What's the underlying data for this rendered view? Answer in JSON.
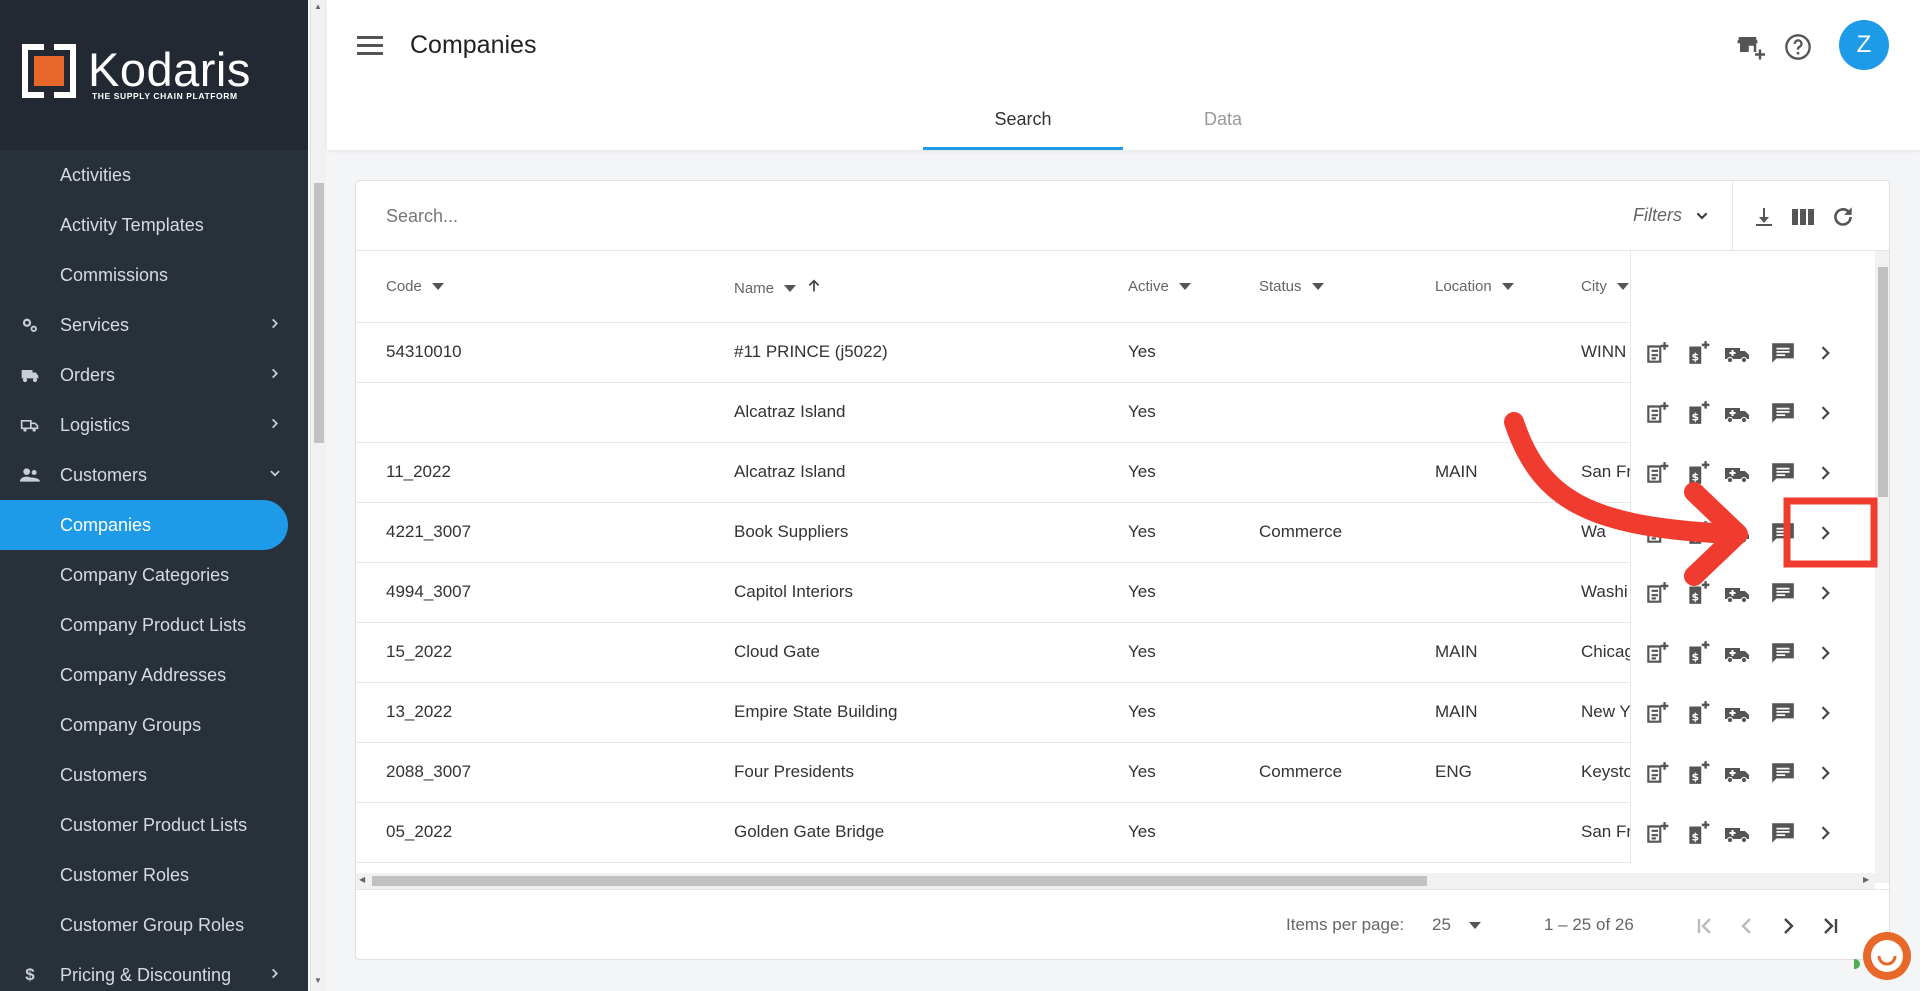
{
  "brand": {
    "name": "Kodaris",
    "tagline": "THE SUPPLY CHAIN PLATFORM",
    "accent": "#1e9be8",
    "logo_orange": "#e8682a"
  },
  "sidebar": {
    "items": [
      {
        "label": "Activities",
        "type": "sub"
      },
      {
        "label": "Activity Templates",
        "type": "sub"
      },
      {
        "label": "Commissions",
        "type": "sub"
      },
      {
        "label": "Services",
        "type": "parent",
        "icon": "gears-icon",
        "chevron": "›"
      },
      {
        "label": "Orders",
        "type": "parent",
        "icon": "truck-icon",
        "chevron": "›"
      },
      {
        "label": "Logistics",
        "type": "parent",
        "icon": "van-icon",
        "chevron": "›"
      },
      {
        "label": "Customers",
        "type": "parent",
        "icon": "people-icon",
        "chevron": "⌄"
      },
      {
        "label": "Companies",
        "type": "sub",
        "active": true
      },
      {
        "label": "Company Categories",
        "type": "sub"
      },
      {
        "label": "Company Product Lists",
        "type": "sub"
      },
      {
        "label": "Company Addresses",
        "type": "sub"
      },
      {
        "label": "Company Groups",
        "type": "sub"
      },
      {
        "label": "Customers",
        "type": "sub"
      },
      {
        "label": "Customer Product Lists",
        "type": "sub"
      },
      {
        "label": "Customer Roles",
        "type": "sub"
      },
      {
        "label": "Customer Group Roles",
        "type": "sub"
      },
      {
        "label": "Pricing & Discounting",
        "type": "parent",
        "icon": "dollar-icon",
        "chevron": "›"
      }
    ]
  },
  "header": {
    "title": "Companies",
    "avatar_letter": "Z",
    "tabs": [
      {
        "label": "Search",
        "active": true
      },
      {
        "label": "Data",
        "active": false
      }
    ]
  },
  "toolbar": {
    "search_placeholder": "Search...",
    "filters_label": "Filters"
  },
  "table": {
    "columns": [
      {
        "key": "code",
        "label": "Code"
      },
      {
        "key": "name",
        "label": "Name"
      },
      {
        "key": "active",
        "label": "Active"
      },
      {
        "key": "status",
        "label": "Status"
      },
      {
        "key": "location",
        "label": "Location"
      },
      {
        "key": "city",
        "label": "City"
      }
    ],
    "rows": [
      {
        "code": "54310010",
        "name": "#11 PRINCE (j5022)",
        "active": "Yes",
        "status": "",
        "location": "",
        "city": "WINN"
      },
      {
        "code": "",
        "name": "Alcatraz Island",
        "active": "Yes",
        "status": "",
        "location": "",
        "city": ""
      },
      {
        "code": "11_2022",
        "name": "Alcatraz Island",
        "active": "Yes",
        "status": "",
        "location": "MAIN",
        "city": "San Fr"
      },
      {
        "code": "4221_3007",
        "name": "Book Suppliers",
        "active": "Yes",
        "status": "Commerce",
        "location": "",
        "city": "Wa"
      },
      {
        "code": "4994_3007",
        "name": "Capitol Interiors",
        "active": "Yes",
        "status": "",
        "location": "",
        "city": "Washi"
      },
      {
        "code": "15_2022",
        "name": "Cloud Gate",
        "active": "Yes",
        "status": "",
        "location": "MAIN",
        "city": "Chicag"
      },
      {
        "code": "13_2022",
        "name": "Empire State Building",
        "active": "Yes",
        "status": "",
        "location": "MAIN",
        "city": "New Y"
      },
      {
        "code": "2088_3007",
        "name": "Four Presidents",
        "active": "Yes",
        "status": "Commerce",
        "location": "ENG",
        "city": "Keysto"
      },
      {
        "code": "05_2022",
        "name": "Golden Gate Bridge",
        "active": "Yes",
        "status": "",
        "location": "",
        "city": "San Fr"
      }
    ]
  },
  "paginator": {
    "items_per_page_label": "Items per page:",
    "page_size": "25",
    "range_label": "1 – 25 of 26"
  },
  "annotation": {
    "color": "#f03c2e"
  }
}
